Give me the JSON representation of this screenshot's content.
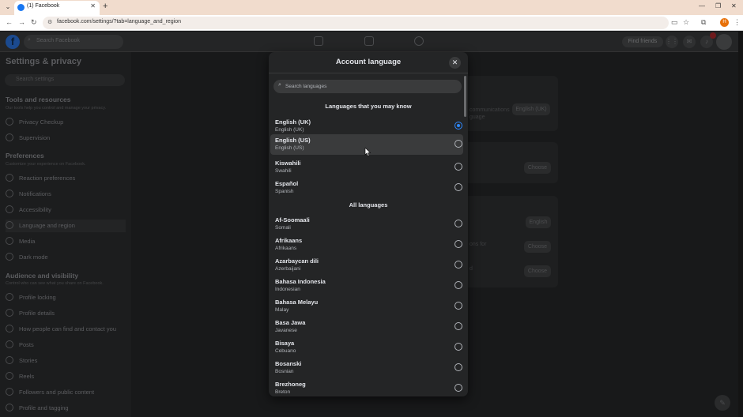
{
  "browser": {
    "tab_title": "(1) Facebook",
    "url": "facebook.com/settings/?tab=language_and_region",
    "profile_initial": "H"
  },
  "fb_header": {
    "search_placeholder": "Search Facebook",
    "find_friends_label": "Find friends",
    "logo_letter": "f"
  },
  "sidebar": {
    "title": "Settings & privacy",
    "search_placeholder": "Search settings",
    "sections": [
      {
        "title": "Tools and resources",
        "subtitle": "Our tools help you control and manage your privacy.",
        "items": [
          "Privacy Checkup",
          "Supervision"
        ]
      },
      {
        "title": "Preferences",
        "subtitle": "Customize your experience on Facebook.",
        "items": [
          "Reaction preferences",
          "Notifications",
          "Accessibility",
          "Language and region",
          "Media",
          "Dark mode"
        ]
      },
      {
        "title": "Audience and visibility",
        "subtitle": "Control who can see what you share on Facebook.",
        "items": [
          "Profile locking",
          "Profile details",
          "How people can find and contact you",
          "Posts",
          "Stories",
          "Reels",
          "Followers and public content",
          "Profile and tagging"
        ]
      }
    ]
  },
  "background": {
    "english_uk_btn": "English (UK)",
    "choose_btn": "Choose",
    "english_btn": "English",
    "frag_1": "communications",
    "frag_2": "guage",
    "frag_3": "ons for",
    "frag_4": "d"
  },
  "modal": {
    "title": "Account language",
    "search_placeholder": "Search languages",
    "known_heading": "Languages that you may know",
    "all_heading": "All languages",
    "known_languages": [
      {
        "name": "English (UK)",
        "native": "English (UK)",
        "selected": true
      },
      {
        "name": "English (US)",
        "native": "English (US)",
        "selected": false
      },
      {
        "name": "Kiswahili",
        "native": "Swahili",
        "selected": false
      },
      {
        "name": "Español",
        "native": "Spanish",
        "selected": false
      }
    ],
    "all_languages": [
      {
        "name": "Af-Soomaali",
        "native": "Somali",
        "selected": false
      },
      {
        "name": "Afrikaans",
        "native": "Afrikaans",
        "selected": false
      },
      {
        "name": "Azarbaycan dili",
        "native": "Azerbaijani",
        "selected": false
      },
      {
        "name": "Bahasa Indonesia",
        "native": "Indonesian",
        "selected": false
      },
      {
        "name": "Bahasa Melayu",
        "native": "Malay",
        "selected": false
      },
      {
        "name": "Basa Jawa",
        "native": "Javanese",
        "selected": false
      },
      {
        "name": "Bisaya",
        "native": "Cebuano",
        "selected": false
      },
      {
        "name": "Bosanski",
        "native": "Bosnian",
        "selected": false
      },
      {
        "name": "Brezhoneg",
        "native": "Breton",
        "selected": false
      }
    ]
  },
  "colors": {
    "accent": "#2d88ff",
    "modal_bg": "#242526",
    "overlay": "#18191a"
  }
}
